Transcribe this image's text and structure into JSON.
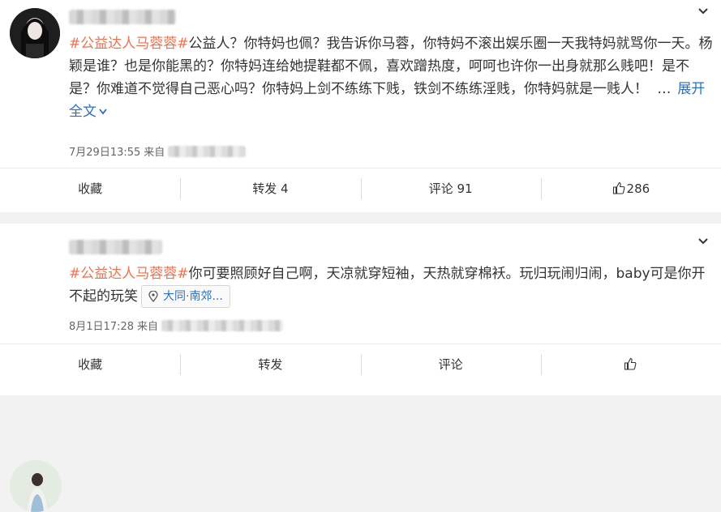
{
  "posts": [
    {
      "tag": "#公益达人马蓉蓉#",
      "text": "公益人？你特妈也佩？我告诉你马蓉，你特妈不滚出娱乐圈一天我特妈就骂你一天。杨颖是谁？也是你能黑的？你特妈连给她提鞋都不佩，喜欢蹭热度，呵呵也许你一出身就那么贱吧！是不是？你难道不觉得自己恶心吗？你特妈上剑不练练下贱，铁剑不练练淫贱，你特妈就是一贱人！",
      "ellipsis": "…",
      "expand": "展开全文",
      "time": "7月29日13:55",
      "from": "来自",
      "actions": {
        "collect": "收藏",
        "repost": "转发 4",
        "comment": "评论 91",
        "like": "286"
      }
    },
    {
      "tag": "#公益达人马蓉蓉#",
      "text": "你可要照顾好自己啊，天凉就穿短袖，天热就穿棉袄。玩归玩闹归闹，baby可是你开不起的玩笑",
      "location": "大同·南郊...",
      "time": "8月1日17:28",
      "from": "来自",
      "actions": {
        "collect": "收藏",
        "repost": "转发",
        "comment": "评论",
        "like": ""
      }
    }
  ],
  "icons": {
    "chevron": "chevron-down-icon",
    "thumb": "thumbs-up-icon",
    "pin": "location-pin-icon"
  }
}
